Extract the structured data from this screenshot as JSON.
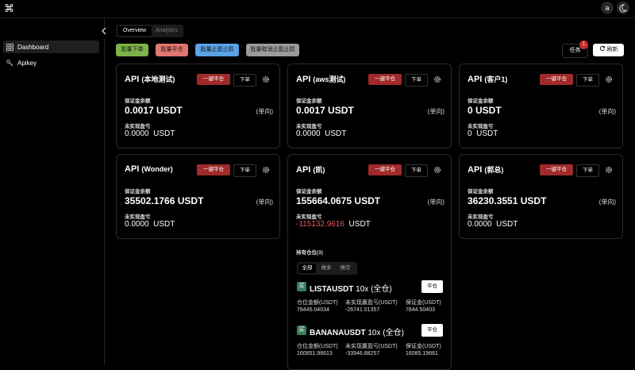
{
  "header": {
    "logo": "⌘",
    "avatar": "a"
  },
  "sidebar": {
    "items": [
      {
        "label": "Dashboard"
      },
      {
        "label": "Apikey"
      }
    ]
  },
  "tabs": [
    {
      "label": "Overview"
    },
    {
      "label": "Analytics"
    }
  ],
  "actions": {
    "batch_order": "批量下单",
    "batch_close": "批量平仓",
    "batch_tpsl": "批量止盈止损",
    "batch_cancel_tpsl": "批量取消止盈止损",
    "tasks": "任务",
    "tasks_count": "1",
    "refresh": "刷新"
  },
  "colors": {
    "green": "#7bb34a",
    "red": "#e0776f",
    "blue": "#5aa2e8",
    "gray": "#9b9b9b",
    "danger": "#a12a2a",
    "negative": "#e05a5a"
  },
  "labels": {
    "api": "API",
    "close_all": "一键平仓",
    "order": "下单",
    "margin_balance": "保证金余额",
    "unrealized_pnl": "未实现盈亏",
    "positions": "持有仓位(3)",
    "seg_all": "全部",
    "seg_long": "做多",
    "seg_short": "做空",
    "pos_value": "仓位金额(USDT)",
    "pos_pnl": "未实现赢盈亏(USDT)",
    "pos_margin": "保证金(USDT)",
    "close": "平仓"
  },
  "cards": [
    {
      "name": "(本地测试)",
      "balance": "0.0017 USDT",
      "direction": "(单向)",
      "pnl": "0.0000",
      "pnl_unit": "USDT"
    },
    {
      "name": "(aws测试)",
      "balance": "0.0017 USDT",
      "direction": "(单向)",
      "pnl": "0.0000",
      "pnl_unit": "USDT"
    },
    {
      "name": "(客户1)",
      "balance": "0 USDT",
      "direction": "(单向)",
      "pnl": "0",
      "pnl_unit": "USDT"
    },
    {
      "name": "(Wonder)",
      "balance": "35502.1766 USDT",
      "direction": "(单向)",
      "pnl": "0.0000",
      "pnl_unit": "USDT"
    },
    {
      "name": "(凯)",
      "balance": "155664.0675 USDT",
      "direction": "(单向)",
      "pnl": "-115132.9616",
      "pnl_unit": "USDT"
    },
    {
      "name": "(郭总)",
      "balance": "36230.3551 USDT",
      "direction": "(单向)",
      "pnl": "0.0000",
      "pnl_unit": "USDT"
    }
  ],
  "positions": [
    {
      "badge": "买",
      "symbol": "LISTAUSDT",
      "leverage": "10x",
      "mode": "(全仓)",
      "value": "78445.04034",
      "pnl": "-26741.01357",
      "margin": "7844.50403"
    },
    {
      "badge": "买",
      "symbol": "BANANAUSDT",
      "leverage": "10x",
      "mode": "(全仓)",
      "value": "160851.96613",
      "pnl": "-33946.88257",
      "margin": "16085.19661"
    }
  ]
}
